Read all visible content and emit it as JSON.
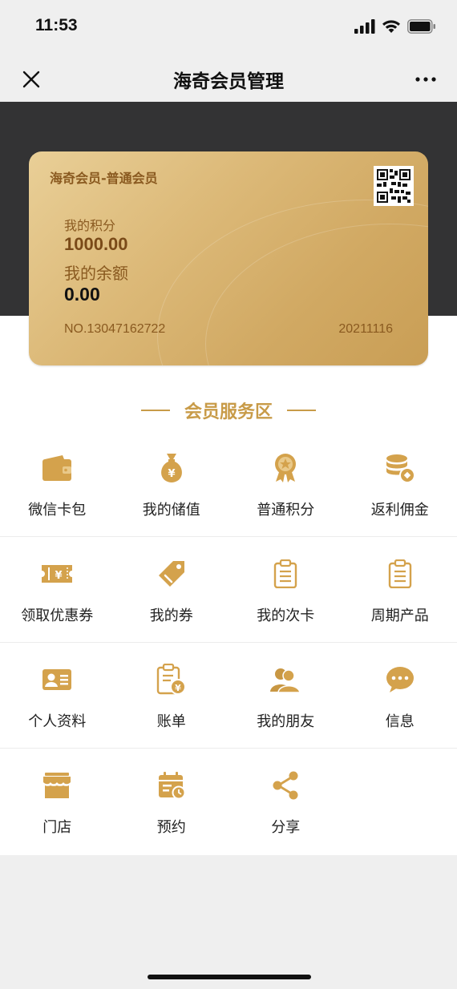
{
  "status": {
    "time": "11:53"
  },
  "nav": {
    "title": "海奇会员管理"
  },
  "card": {
    "title": "海奇会员-普通会员",
    "points_label": "我的积分",
    "points_value": "1000.00",
    "balance_label": "我的余额",
    "balance_value": "0.00",
    "number": "NO.13047162722",
    "date": "20211116"
  },
  "section": {
    "title": "会员服务区"
  },
  "services": [
    {
      "label": "微信卡包",
      "icon": "wallet-icon"
    },
    {
      "label": "我的储值",
      "icon": "money-bag-icon"
    },
    {
      "label": "普通积分",
      "icon": "medal-icon"
    },
    {
      "label": "返利佣金",
      "icon": "coins-icon"
    },
    {
      "label": "领取优惠券",
      "icon": "ticket-icon"
    },
    {
      "label": "我的券",
      "icon": "tag-icon"
    },
    {
      "label": "我的次卡",
      "icon": "clipboard-icon"
    },
    {
      "label": "周期产品",
      "icon": "clipboard-icon"
    },
    {
      "label": "个人资料",
      "icon": "id-card-icon"
    },
    {
      "label": "账单",
      "icon": "bill-icon"
    },
    {
      "label": "我的朋友",
      "icon": "friends-icon"
    },
    {
      "label": "信息",
      "icon": "chat-bubble-icon"
    },
    {
      "label": "门店",
      "icon": "store-icon"
    },
    {
      "label": "预约",
      "icon": "calendar-icon"
    },
    {
      "label": "分享",
      "icon": "share-icon"
    }
  ],
  "colors": {
    "accent": "#c89b48",
    "dark_band": "#333334",
    "page_bg": "#efefef"
  }
}
